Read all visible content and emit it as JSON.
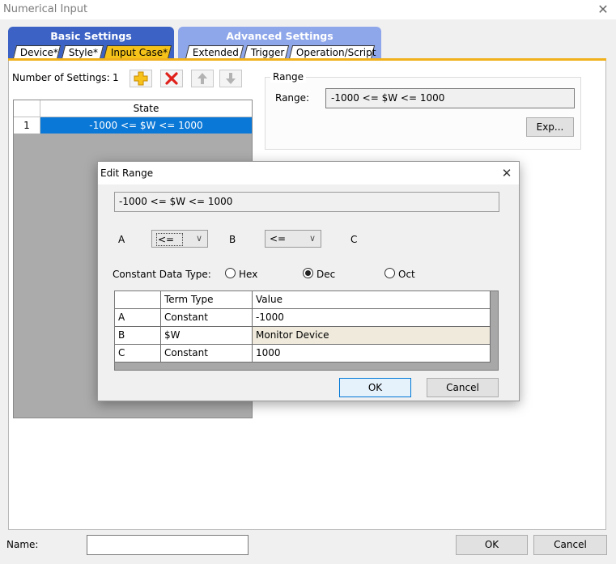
{
  "window": {
    "title": "Numerical Input"
  },
  "tab_groups": [
    {
      "label": "Basic Settings"
    },
    {
      "label": "Advanced Settings"
    }
  ],
  "tabs": [
    {
      "label": "Device*",
      "active": false
    },
    {
      "label": "Style*",
      "active": false
    },
    {
      "label": "Input Case*",
      "active": true
    },
    {
      "label": "Extended",
      "active": false
    },
    {
      "label": "Trigger",
      "active": false
    },
    {
      "label": "Operation/Script",
      "active": false
    }
  ],
  "settings": {
    "count_label": "Number of Settings:",
    "count": "1",
    "toolbar": [
      "add-icon",
      "delete-icon",
      "move-up-icon",
      "move-down-icon"
    ]
  },
  "state_grid": {
    "header": "State",
    "rows": [
      {
        "num": "1",
        "state": "-1000 <= $W <= 1000"
      }
    ]
  },
  "range": {
    "group_label": "Range",
    "field_label": "Range:",
    "value": "-1000 <= $W <= 1000",
    "exp_button": "Exp..."
  },
  "edit_range": {
    "title": "Edit Range",
    "expression": "-1000 <= $W <= 1000",
    "label_a": "A",
    "label_b": "B",
    "label_c": "C",
    "op1": "<=",
    "op2": "<=",
    "constant_type_label": "Constant Data Type:",
    "types": [
      {
        "label": "Hex",
        "checked": false
      },
      {
        "label": "Dec",
        "checked": true
      },
      {
        "label": "Oct",
        "checked": false
      }
    ],
    "columns": [
      "Term Type",
      "Value"
    ],
    "rows": [
      {
        "id": "A",
        "term": "Constant",
        "value": "-1000"
      },
      {
        "id": "B",
        "term": "$W",
        "value": "Monitor Device"
      },
      {
        "id": "C",
        "term": "Constant",
        "value": "1000"
      }
    ],
    "ok": "OK",
    "cancel": "Cancel"
  },
  "footer": {
    "name_label": "Name:",
    "name_value": "",
    "ok": "OK",
    "cancel": "Cancel"
  },
  "colors": {
    "accent": "#3b62c4",
    "active_tab": "#f5c21a",
    "selection": "#0a78d7"
  }
}
